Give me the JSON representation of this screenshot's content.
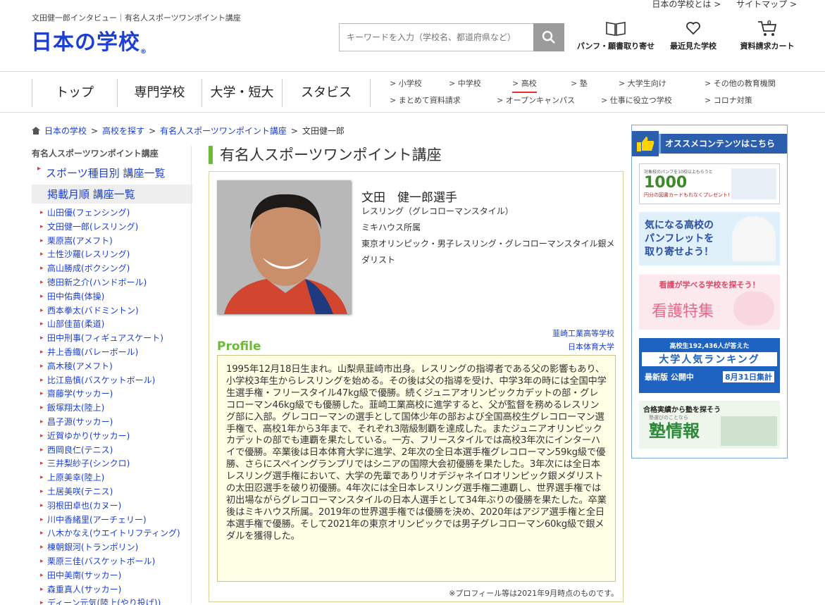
{
  "header": {
    "top_links": [
      "日本の学校とは >",
      "サイトマップ >"
    ],
    "tagline": "文田健一郎インタビュー｜有名人スポーツワンポイント講座",
    "logo": "日本の学校",
    "search_placeholder": "キーワードを入力（学校名、都道府県など）",
    "icons": [
      {
        "label": "パンフ・願書取り寄せ",
        "icon": "book-icon"
      },
      {
        "label": "最近見た学校",
        "icon": "heart-icon"
      },
      {
        "label": "資料請求カート",
        "icon": "cart-icon"
      }
    ]
  },
  "nav": {
    "main": [
      "トップ",
      "専門学校",
      "大学・短大",
      "スタビス"
    ],
    "sub_row1": [
      "> 小学校",
      "> 中学校",
      "> 高校",
      "> 塾",
      "> 大学生向け",
      "> その他の教育機関"
    ],
    "sub_row2": [
      "> まとめて資料請求",
      "> オープンキャンパス",
      "> 仕事に役立つ学校",
      "> コロナ対策"
    ],
    "accent": "#e33333"
  },
  "breadcrumb": [
    "日本の学校",
    "高校を探す",
    "有名人スポーツワンポイント講座",
    "文田健一郎"
  ],
  "sidebar": {
    "heading": "有名人スポーツワンポイント講座",
    "main_links": [
      "スポーツ種目別 講座一覧",
      "掲載月順 講座一覧"
    ],
    "items": [
      "山田優(フェンシング)",
      "文田健一郎(レスリング)",
      "栗原嵩(アメフト)",
      "土性沙羅(レスリング)",
      "高山勝成(ボクシング)",
      "徳田新之介(ハンドボール)",
      "田中佑典(体操)",
      "西本拳太(バドミントン)",
      "山部佳苗(柔道)",
      "田中刑事(フィギュアスケート)",
      "井上香織(バレーボール)",
      "高木稜(アメフト)",
      "比江島慎(バスケットボール)",
      "齋藤学(サッカー)",
      "飯塚翔太(陸上)",
      "昌子源(サッカー)",
      "近賀ゆかり(サッカー)",
      "西岡良仁(テニス)",
      "三井梨紗子(シンクロ)",
      "上原美幸(陸上)",
      "土居美咲(テニス)",
      "羽根田卓也(カヌー)",
      "川中香緒里(アーチェリー)",
      "八木かなえ(ウエイトリフティング)",
      "棟朝銀河(トランポリン)",
      "栗原三佳(バスケットボール)",
      "田中美南(サッカー)",
      "森重真人(サッカー)",
      "ディーン元気(陸上(やり投げ))"
    ]
  },
  "main": {
    "title": "有名人スポーツワンポイント講座",
    "athlete": {
      "name": "文田　健一郎選手",
      "sport": "レスリング（グレコローマンスタイル）",
      "affiliation": "ミキハウス所属",
      "achievement": "東京オリンピック・男子レスリング・グレコローマンスタイル銀メダリスト",
      "schools": [
        "韮崎工業高等学校",
        "日本体育大学"
      ]
    },
    "profile_label": "Profile",
    "profile_text": "1995年12月18日生まれ。山梨県韮崎市出身。レスリングの指導者である父の影響もあり、小学校3年生からレスリングを始める。その後は父の指導を受け、中学3年の時には全国中学生選手権・フリースタイル47kg級で優勝。続くジュニアオリンピックカデットの部・グレコローマン46kg級でも優勝した。韮崎工業高校に進学すると、父が監督を務めるレスリング部に入部。グレコローマンの選手として国体少年の部および全国高校生グレコローマン選手権で、高校1年から3年まで、それぞれ3階級制覇を達成した。またジュニアオリンピックカデットの部でも連覇を果たしている。一方、フリースタイルでは高校3年次にインターハイで優勝。卒業後は日本体育大学に進学、2年次の全日本選手権グレコローマン59kg級で優勝、さらにスペイングランプリではシニアの国際大会初優勝を果たした。3年次には全日本レスリング選手権において、大学の先輩でありリオデジャネイロオリンピック銀メダリストの太田忍選手を破り初優勝。4年次には全日本レスリング選手権二連覇し、世界選手権では初出場ながらグレコローマンスタイルの日本人選手として34年ぶりの優勝を果たした。卒業後はミキハウス所属。2019年の世界選手権では優勝を決め、2020年はアジア選手権と全日本選手権で優勝。そして2021年の東京オリンピックでは男子グレコローマン60kg級で銀メダルを獲得した。",
    "note": "※プロフィール等は2021年9月時点のものです。"
  },
  "recommend": {
    "title": "オススメコンテンツはこちら",
    "banners": [
      {
        "line1": "対象校のパンフを10校以上もらうと",
        "big": "1000",
        "line2": "円分の図書カードもれなくプレゼント!"
      },
      {
        "line1": "気になる高校の",
        "line2": "パンフレットを",
        "line3": "取り寄せよう！"
      },
      {
        "line1": "看護が学べる学校を探そう！",
        "big": "看護特集"
      },
      {
        "line1": "高校生192,436人が答えた",
        "big": "大学人気ランキング",
        "line2": "最新版 公開中",
        "date": "8月31日集計"
      },
      {
        "line1": "合格実績から塾を探そう",
        "sub": "塾選びのことなら",
        "big": "塾情報"
      }
    ]
  }
}
